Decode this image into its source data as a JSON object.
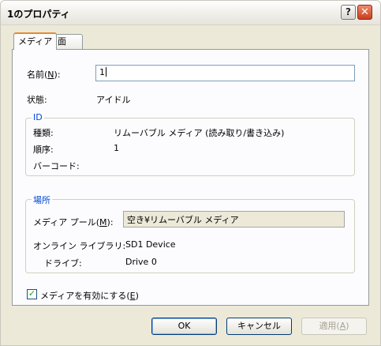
{
  "window": {
    "title": "1のプロパティ"
  },
  "tabs": [
    {
      "label": "メディア"
    },
    {
      "label": "面"
    }
  ],
  "name_field": {
    "label_pre": "名前(",
    "accel": "N",
    "label_post": "):",
    "value": "1"
  },
  "status": {
    "label": "状態:",
    "value": "アイドル"
  },
  "id_group": {
    "legend": "ID",
    "type_label": "種類:",
    "type_value": "リムーバブル メディア (読み取り/書き込み)",
    "order_label": "順序:",
    "order_value": "1",
    "barcode_label": "バーコード:",
    "barcode_value": ""
  },
  "location_group": {
    "legend": "場所",
    "pool_label_pre": "メディア プール(",
    "pool_accel": "M",
    "pool_label_post": "):",
    "pool_value": "空き¥リムーバブル メディア",
    "library_label": "オンライン ライブラリ:",
    "library_value": "SD1 Device",
    "drive_label": "ドライブ:",
    "drive_value": "Drive 0"
  },
  "enable_media": {
    "label_pre": "メディアを有効にする(",
    "accel": "E",
    "label_post": ")",
    "checked": true
  },
  "buttons": {
    "ok": "OK",
    "cancel": "キャンセル",
    "apply_pre": "適用(",
    "apply_accel": "A",
    "apply_post": ")"
  },
  "icons": {
    "help": "help-icon",
    "close": "close-icon",
    "check": "checkmark-icon"
  }
}
